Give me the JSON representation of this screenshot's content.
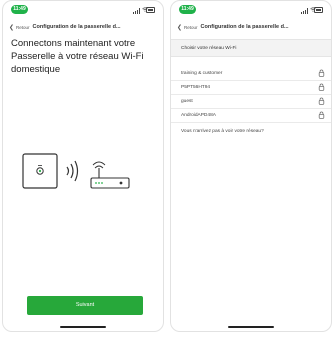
{
  "screens": [
    {
      "status_time": "11:49",
      "nav": {
        "back_label": "Retour",
        "title": "Configuration de la passerelle d..."
      },
      "headline": "Connectons maintenant votre Passerelle à votre réseau Wi-Fi domestique",
      "next_button": "Suivant"
    },
    {
      "status_time": "11:49",
      "nav": {
        "back_label": "Retour",
        "title": "Configuration de la passerelle d..."
      },
      "section_header": "Choisir votre réseau Wi-Fi",
      "networks": [
        {
          "name": "training & customer"
        },
        {
          "name": "P5PT56HT94"
        },
        {
          "name": "guest"
        },
        {
          "name": "AndroidAPD48A"
        }
      ],
      "help_link": "Vous n'arrivez pas à voir votre réseau?"
    }
  ],
  "colors": {
    "accent_green": "#27a83a",
    "status_pill": "#20b24a"
  },
  "icons": {
    "back": "chevron-left-icon",
    "gateway": "gateway-device-icon",
    "signal_waves": "wireless-signal-icon",
    "router": "router-icon",
    "lock": "lock-icon"
  }
}
